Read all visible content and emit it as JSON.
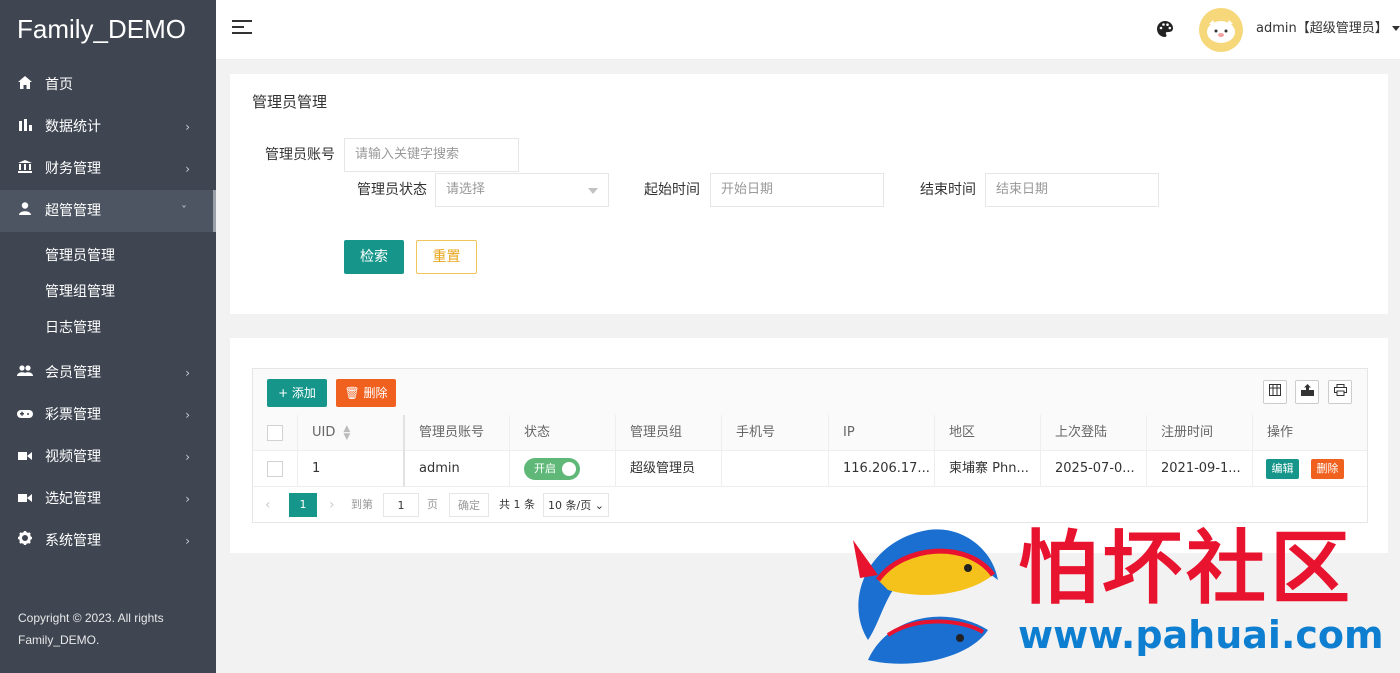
{
  "brand": "Family_DEMO",
  "sidebar": {
    "items": [
      {
        "label": "首页",
        "icon": "home-icon"
      },
      {
        "label": "数据统计",
        "icon": "bar-chart-icon"
      },
      {
        "label": "财务管理",
        "icon": "bank-icon"
      },
      {
        "label": "超管管理",
        "icon": "user-icon"
      },
      {
        "label": "会员管理",
        "icon": "users-icon"
      },
      {
        "label": "彩票管理",
        "icon": "gamepad-icon"
      },
      {
        "label": "视频管理",
        "icon": "video-icon"
      },
      {
        "label": "选妃管理",
        "icon": "video-icon"
      },
      {
        "label": "系统管理",
        "icon": "gear-icon"
      }
    ],
    "sub_items": [
      "管理员管理",
      "管理组管理",
      "日志管理"
    ],
    "copyright": "Copyright © 2023. All rights Family_DEMO."
  },
  "header": {
    "user": "admin【超级管理员】"
  },
  "search": {
    "title": "管理员管理",
    "account_label": "管理员账号",
    "account_placeholder": "请输入关键字搜索",
    "status_label": "管理员状态",
    "status_placeholder": "请选择",
    "start_label": "起始时间",
    "start_placeholder": "开始日期",
    "end_label": "结束时间",
    "end_placeholder": "结束日期",
    "search_btn": "检索",
    "reset_btn": "重置"
  },
  "table": {
    "add_btn": "+ 添加",
    "delete_btn": "删除",
    "columns": [
      "UID",
      "管理员账号",
      "状态",
      "管理员组",
      "手机号",
      "IP",
      "地区",
      "上次登陆",
      "注册时间",
      "操作"
    ],
    "rows": [
      {
        "uid": "1",
        "account": "admin",
        "status": "开启",
        "group": "超级管理员",
        "phone": "",
        "ip": "116.206.17...",
        "region": "柬埔寨 Phn...",
        "last_login": "2025-07-0...",
        "registered": "2021-09-1...",
        "edit": "编辑",
        "remove": "删除"
      }
    ]
  },
  "pager": {
    "current": "1",
    "goto_label": "到第",
    "goto_value": "1",
    "page_unit": "页",
    "confirm": "确定",
    "total": "共 1 条",
    "per_page": "10 条/页"
  },
  "watermark": {
    "title": "怕坏社区",
    "url": "www.pahuai.com"
  }
}
